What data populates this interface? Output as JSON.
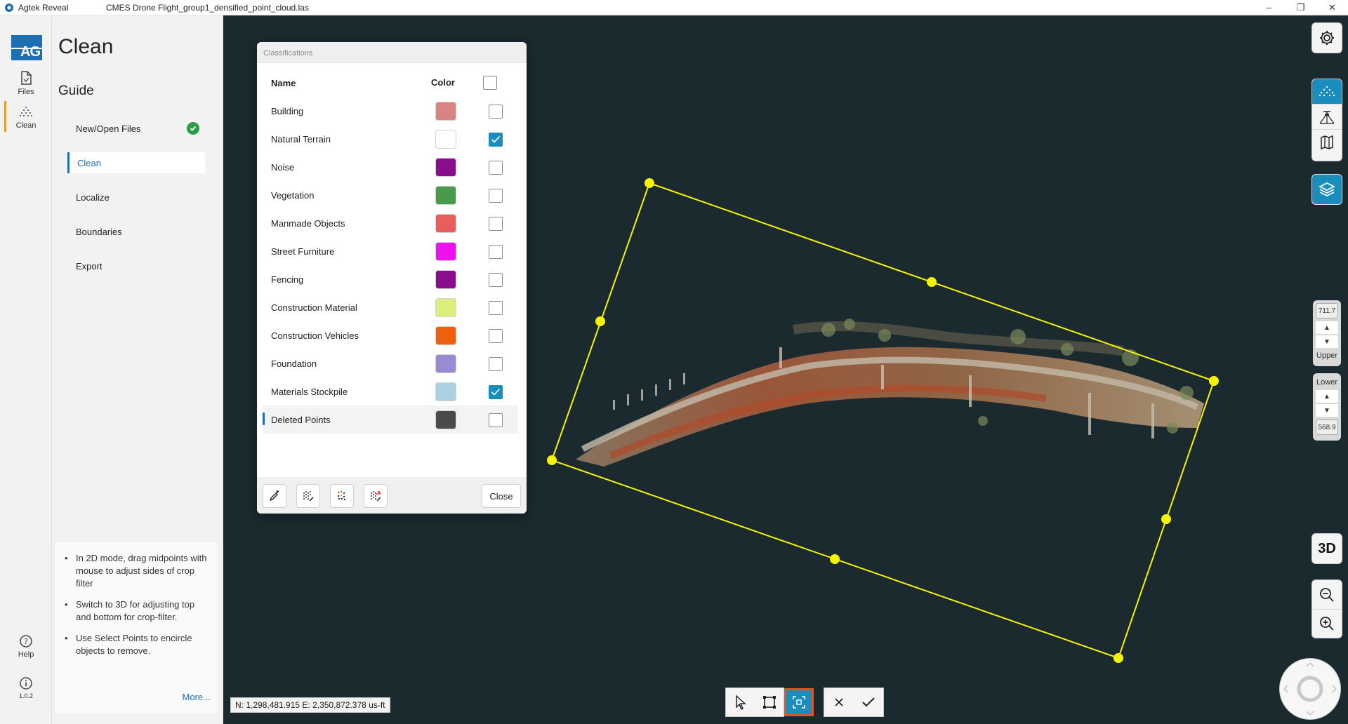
{
  "titlebar": {
    "app_name": "Agtek Reveal",
    "file_name": "CMES Drone Flight_group1_densified_point_cloud.las"
  },
  "rail": {
    "logo_text": "AG",
    "files_label": "Files",
    "clean_label": "Clean",
    "help_label": "Help",
    "version_label": "1.0.2"
  },
  "guide": {
    "page_title": "Clean",
    "section_title": "Guide",
    "steps": [
      {
        "label": "New/Open Files",
        "done": true
      },
      {
        "label": "Clean",
        "active": true
      },
      {
        "label": "Localize"
      },
      {
        "label": "Boundaries"
      },
      {
        "label": "Export"
      }
    ],
    "tips": [
      "In 2D mode, drag midpoints with mouse to adjust sides of crop filter",
      "Switch to 3D for adjusting top and bottom for crop-filter.",
      "Use Select Points to encircle objects to remove."
    ],
    "more_link": "More..."
  },
  "classifications": {
    "title": "Classifications",
    "col_name": "Name",
    "col_color": "Color",
    "rows": [
      {
        "name": "Building",
        "color": "#d98483",
        "checked": false
      },
      {
        "name": "Natural Terrain",
        "color": "#ffffff",
        "checked": true
      },
      {
        "name": "Noise",
        "color": "#8a0d8e",
        "checked": false
      },
      {
        "name": "Vegetation",
        "color": "#4a9a4b",
        "checked": false
      },
      {
        "name": "Manmade Objects",
        "color": "#e85e5e",
        "checked": false
      },
      {
        "name": "Street Furniture",
        "color": "#ee11ee",
        "checked": false
      },
      {
        "name": "Fencing",
        "color": "#8a0d8e",
        "checked": false
      },
      {
        "name": "Construction Material",
        "color": "#d9f07c",
        "checked": false
      },
      {
        "name": "Construction Vehicles",
        "color": "#ef5f0e",
        "checked": false
      },
      {
        "name": "Foundation",
        "color": "#9a8ad2",
        "checked": false
      },
      {
        "name": "Materials Stockpile",
        "color": "#a9d3e2",
        "checked": true
      },
      {
        "name": "Deleted Points",
        "color": "#4a4a4a",
        "checked": false
      }
    ],
    "close_label": "Close"
  },
  "elevation": {
    "upper_value": "711.7",
    "upper_label": "Upper",
    "lower_label": "Lower",
    "lower_value": "568.9"
  },
  "view_mode_label": "3D",
  "coordinates": "N: 1,298,481.915 E: 2,350,872.378 us-ft",
  "colors": {
    "accent": "#1a8dbd",
    "crop_box": "#f5f500",
    "viewport_bg": "#1a2a2f",
    "active_outline": "#e0542a"
  }
}
